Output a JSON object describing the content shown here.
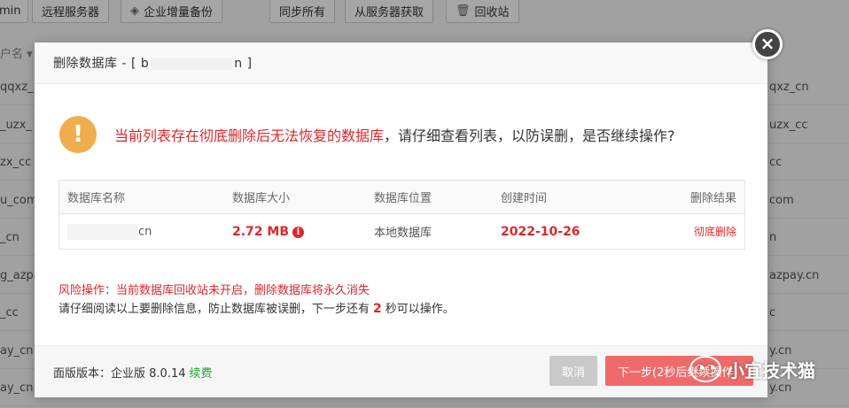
{
  "toolbar": {
    "partial_left": "min",
    "remote_server": "远程服务器",
    "enterprise_backup": "企业增量备份",
    "sync_all": "同步所有",
    "fetch_from_server": "从服务器获取",
    "recycle_bin": "回收站"
  },
  "background_table": {
    "col_head": "户名 ▾",
    "left_cells": [
      "qqxz_",
      "_uzx_",
      "zx_cc",
      "u_com",
      "_cn",
      "g_azpa",
      "_cc",
      "ay_cn",
      "ay_cn"
    ],
    "right_cells": [
      "qxz_cn",
      "uzx_cc",
      "cc",
      "com",
      "n",
      "azpay.cn",
      "c",
      "y.cn",
      "y.cn"
    ]
  },
  "modal": {
    "title_prefix": "删除数据库 - [ b",
    "title_suffix": "n ]",
    "warning_red": "当前列表存在彻底删除后无法恢复的数据库",
    "warning_rest": "，请仔细查看列表，以防误删，是否继续操作?",
    "table": {
      "headers": [
        "数据库名称",
        "数据库大小",
        "数据库位置",
        "创建时间",
        "删除结果"
      ],
      "row": {
        "name_suffix": "cn",
        "size": "2.72 MB",
        "location": "本地数据库",
        "created": "2022-10-26",
        "result": "彻底删除"
      }
    },
    "risk_text": "风险操作：当前数据库回收站未开启，删除数据库将永久消失",
    "notice_before": "请仔细阅读以上要删除信息，防止数据库被误删，下一步还有",
    "notice_count": "2",
    "notice_after": "秒可以操作。",
    "footer": {
      "version_label": "面版版本：企业版 8.0.14",
      "renew": "续费",
      "cancel": "取消",
      "next": "下一步(2秒后继续操作)"
    }
  },
  "watermark": "小宜技术猫",
  "colors": {
    "danger": "#e0262a",
    "warning_icon": "#f0ad4e",
    "renew_green": "#20a53a",
    "next_button": "#ef6b6b"
  }
}
